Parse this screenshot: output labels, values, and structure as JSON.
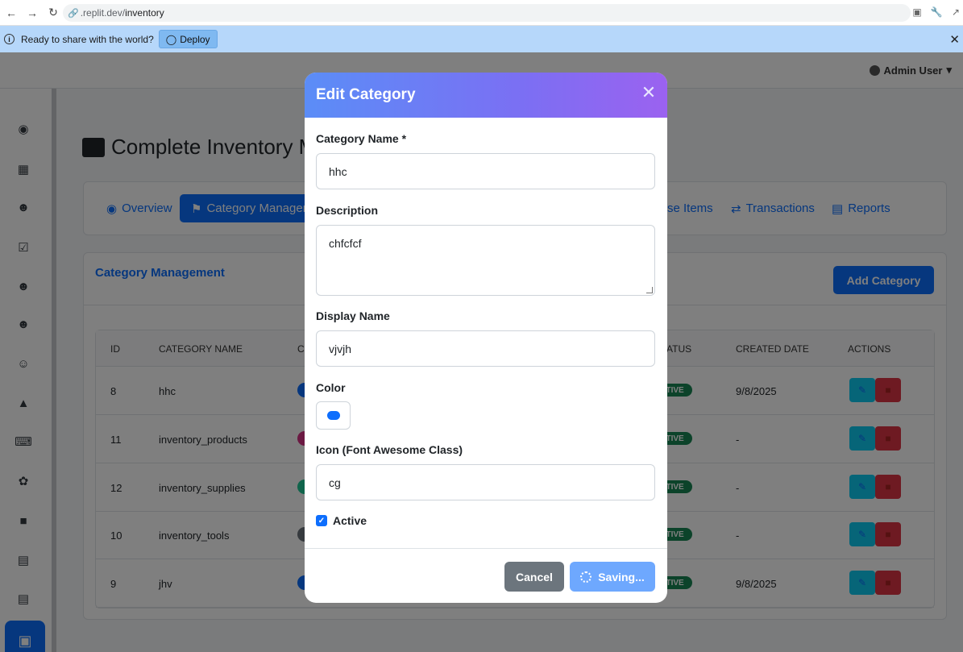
{
  "browser": {
    "url_host": ".replit.dev/",
    "url_path": "inventory"
  },
  "banner": {
    "message": "Ready to share with the world?",
    "deploy_label": "Deploy"
  },
  "topnav": {
    "user_label": "Admin User"
  },
  "page": {
    "title": "Complete Inventory M"
  },
  "tabs": [
    {
      "label": "Overview"
    },
    {
      "label": "Category Managem"
    },
    {
      "label": "se Items"
    },
    {
      "label": "Transactions"
    },
    {
      "label": "Reports"
    }
  ],
  "card": {
    "title": "Category Management",
    "add_button": "Add Category"
  },
  "table": {
    "headers": [
      "ID",
      "CATEGORY NAME",
      "C",
      "ATUS",
      "CREATED DATE",
      "ACTIONS"
    ],
    "rows": [
      {
        "id": "8",
        "name": "hhc",
        "status": "CTIVE",
        "created": "9/8/2025",
        "dot_color": "#0d6efd"
      },
      {
        "id": "11",
        "name": "inventory_products",
        "status": "CTIVE",
        "created": "-",
        "dot_color": "#d63384"
      },
      {
        "id": "12",
        "name": "inventory_supplies",
        "status": "CTIVE",
        "created": "-",
        "dot_color": "#20c997"
      },
      {
        "id": "10",
        "name": "inventory_tools",
        "status": "CTIVE",
        "created": "-",
        "dot_color": "#6c757d"
      },
      {
        "id": "9",
        "name": "jhv",
        "status": "CTIVE",
        "created": "9/8/2025",
        "dot_color": "#0d6efd"
      }
    ]
  },
  "modal": {
    "title": "Edit Category",
    "fields": {
      "name_label": "Category Name *",
      "name_value": "hhc",
      "description_label": "Description",
      "description_value": "chfcfcf",
      "display_label": "Display Name",
      "display_value": "vjvjh",
      "color_label": "Color",
      "color_value": "#0d6efd",
      "icon_label": "Icon (Font Awesome Class)",
      "icon_value": "cg",
      "active_label": "Active",
      "active_checked": true
    },
    "cancel_label": "Cancel",
    "save_label": "Saving..."
  }
}
